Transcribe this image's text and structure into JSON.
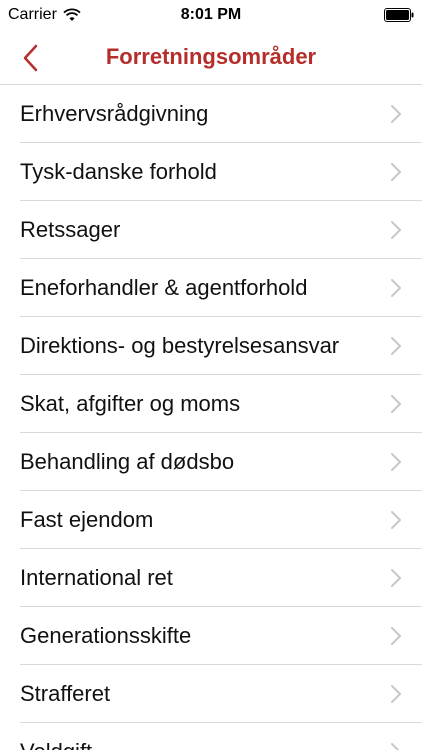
{
  "status_bar": {
    "carrier": "Carrier",
    "time": "8:01 PM",
    "wifi_icon": "wifi-icon",
    "battery_icon": "battery-icon"
  },
  "nav": {
    "title": "Forretningsområder",
    "back_icon": "chevron-left-icon",
    "accent_color": "#b42e2b"
  },
  "list": {
    "items": [
      {
        "label": "Erhvervsrådgivning"
      },
      {
        "label": "Tysk-danske forhold"
      },
      {
        "label": "Retssager"
      },
      {
        "label": "Eneforhandler & agentforhold"
      },
      {
        "label": "Direktions- og bestyrelsesansvar"
      },
      {
        "label": "Skat, afgifter og moms"
      },
      {
        "label": "Behandling af dødsbo"
      },
      {
        "label": "Fast ejendom"
      },
      {
        "label": "International ret"
      },
      {
        "label": "Generationsskifte"
      },
      {
        "label": "Strafferet"
      },
      {
        "label": "Voldgift"
      }
    ]
  }
}
